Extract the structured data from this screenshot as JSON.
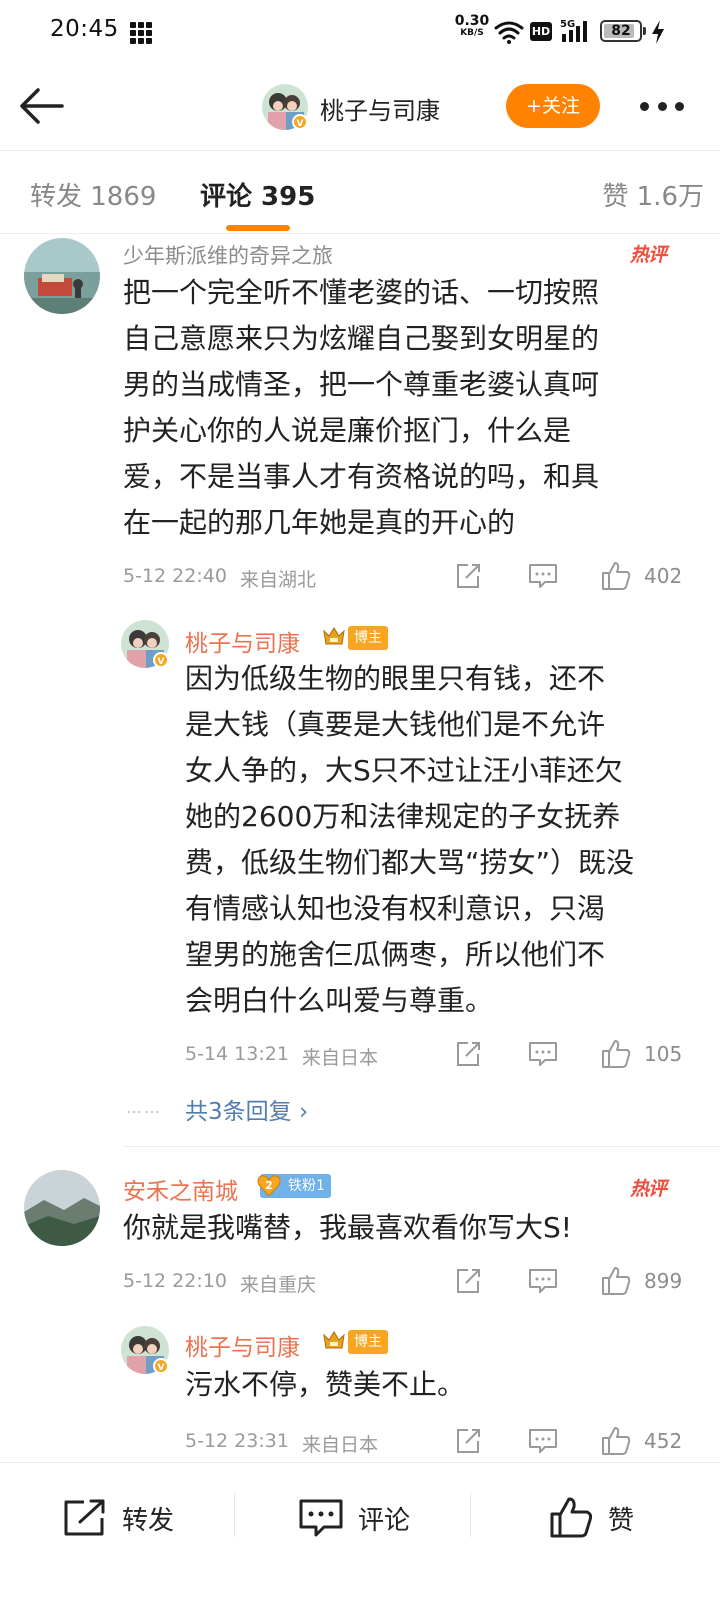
{
  "status_bar": {
    "time": "20:45",
    "net_speed_value": "0.30",
    "net_speed_unit": "KB/S",
    "hd_label": "HD",
    "signal_label": "5G",
    "battery": "82",
    "battery_level": 0.82
  },
  "header": {
    "title": "桃子与司康",
    "follow_label": "+关注"
  },
  "tabs": {
    "repost": "转发 1869",
    "comment": "评论 395",
    "like": "赞 1.6万"
  },
  "comments": [
    {
      "username": "少年斯派维的奇异之旅",
      "hot": "热评",
      "lines": [
        "把一个完全听不懂老婆的话、一切按照",
        "自己意愿来只为炫耀自己娶到女明星的",
        "男的当成情圣，把一个尊重老婆认真呵",
        "护关心你的人说是廉价抠门，什么是",
        "爱，不是当事人才有资格说的吗，和具",
        "在一起的那几年她是真的开心的"
      ],
      "time": "5-12 22:40",
      "location": "来自湖北",
      "likes": "402",
      "reply": {
        "username": "桃子与司康",
        "badge": "博主",
        "lines": [
          "因为低级生物的眼里只有钱，还不",
          "是大钱（真要是大钱他们是不允许",
          "女人争的，大S只不过让汪小菲还欠",
          "她的2600万和法律规定的子女抚养",
          "费，低级生物们都大骂“捞女”）既没",
          "有情感认知也没有权利意识，只渴",
          "望男的施舍仨瓜俩枣，所以他们不",
          "会明白什么叫爱与尊重。"
        ],
        "time": "5-14 13:21",
        "location": "来自日本",
        "likes": "105"
      },
      "more_replies": "共3条回复 ›",
      "more_dots": "……"
    },
    {
      "username": "安禾之南城",
      "fan_badge": "铁粉1",
      "fan_level": "2",
      "hot": "热评",
      "lines": [
        "你就是我嘴替，我最喜欢看你写大S!"
      ],
      "time": "5-12 22:10",
      "location": "来自重庆",
      "likes": "899",
      "reply": {
        "username": "桃子与司康",
        "badge": "博主",
        "lines": [
          "污水不停，赞美不止。"
        ],
        "time": "5-12 23:31",
        "location": "来自日本",
        "likes": "452"
      }
    }
  ],
  "bottom_bar": {
    "repost": "转发",
    "comment": "评论",
    "like": "赞"
  },
  "colors": {
    "accent": "#ff8200",
    "username_orange": "#eb7350",
    "hot_red": "#f04e3e",
    "link_blue": "#507daf"
  },
  "icons": [
    "back-icon",
    "more-icon",
    "share-icon",
    "comment-icon",
    "like-icon",
    "crown-icon",
    "fan-heart-icon",
    "wifi-icon",
    "signal-icon",
    "battery-icon",
    "bolt-icon"
  ]
}
